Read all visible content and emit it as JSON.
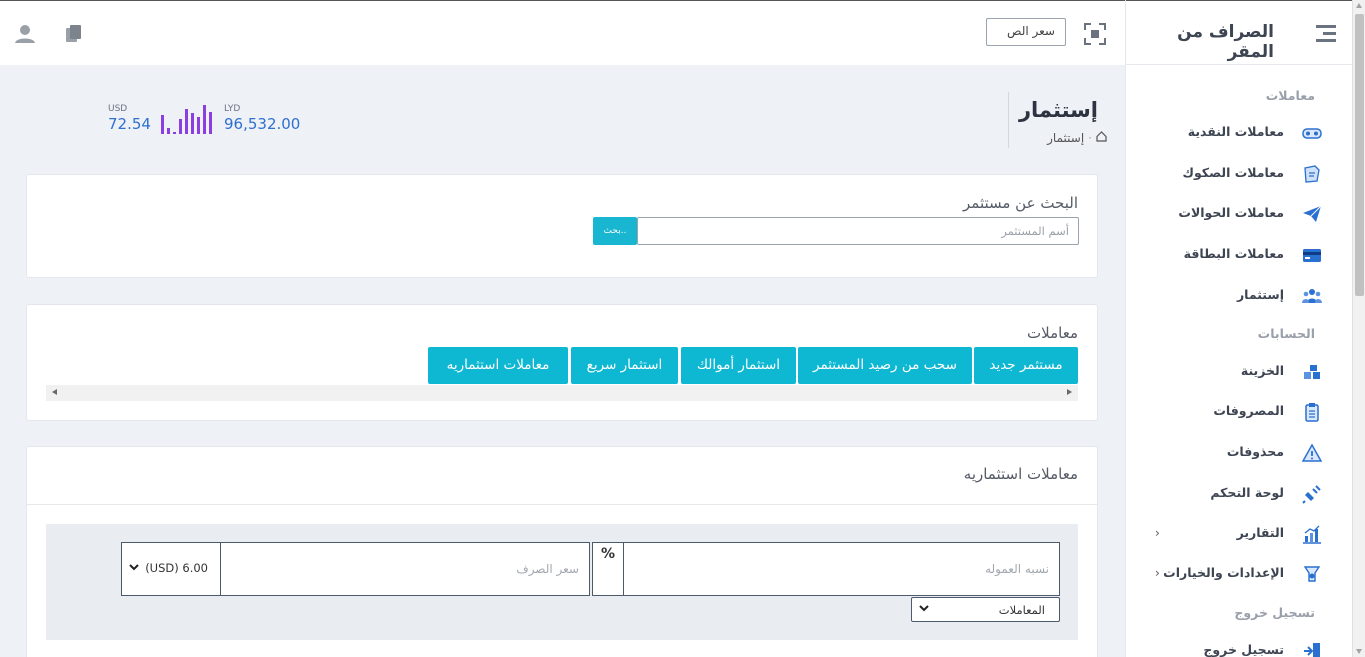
{
  "app": {
    "title": "الصراف من المقر",
    "rate_box": "سعر الص"
  },
  "sidebar": {
    "section_transactions": "معاملات",
    "section_accounts": "الحسابات",
    "section_logout": "تسجيل خروج",
    "items": [
      {
        "label": "معاملات النقدية",
        "icon": "cash-icon"
      },
      {
        "label": "معاملات الصكوك",
        "icon": "cheque-icon"
      },
      {
        "label": "معاملات الحوالات",
        "icon": "send-icon"
      },
      {
        "label": "معاملات البطاقة",
        "icon": "card-icon"
      },
      {
        "label": "إستثمار",
        "icon": "people-icon"
      },
      {
        "label": "الخزينة",
        "icon": "safe-icon"
      },
      {
        "label": "المصروفات",
        "icon": "clipboard-icon"
      },
      {
        "label": "محذوفات",
        "icon": "warning-icon"
      },
      {
        "label": "لوحة التحكم",
        "icon": "plug-icon"
      },
      {
        "label": "التقارير",
        "icon": "chart-icon"
      },
      {
        "label": "الإعدادات والخيارات",
        "icon": "settings-icon"
      },
      {
        "label": "تسجيل خروج",
        "icon": "logout-icon"
      }
    ]
  },
  "page": {
    "title": "إستثمار",
    "breadcrumb": "إستثمار",
    "stats": {
      "lyd_label": "LYD",
      "lyd_value": "96,532.00",
      "usd_label": "USD",
      "usd_value": "72.54"
    }
  },
  "search_card": {
    "label": "البحث عن مستثمر",
    "placeholder": "أسم المستثمر",
    "button": "بحث.."
  },
  "transactions_card": {
    "label": "معاملات",
    "buttons": [
      "مستثمر جديد",
      "سحب من رصيد المستثمر",
      "استثمار أموالك",
      "استثمار سريع",
      "معاملات استثماريه"
    ]
  },
  "investment_card": {
    "title": "معاملات استثماريه",
    "commission_placeholder": "نسبه العموله",
    "percent": "%",
    "rate_placeholder": "سعر الصرف",
    "currency_value": "(USD) 6.00",
    "transaction_select": "المعاملات"
  },
  "colors": {
    "accent": "#0fb8d2",
    "stat_value": "#2f6fd0",
    "bars": "#8b3fe0"
  }
}
